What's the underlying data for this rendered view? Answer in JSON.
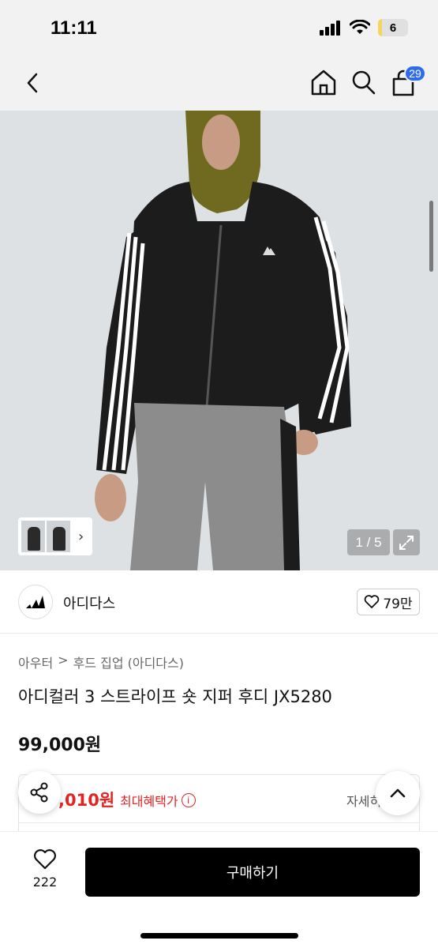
{
  "status_bar": {
    "time": "11:11",
    "battery_level": "6",
    "battery_fraction": 0.06
  },
  "nav": {
    "cart_count": "29"
  },
  "hero": {
    "counter": "1 / 5"
  },
  "brand": {
    "name": "아디다스",
    "likes": "79만"
  },
  "breadcrumb": {
    "first": "아우터",
    "separator": ">",
    "second": "후드 집업 (아디다스)"
  },
  "product": {
    "title": "아디컬러 3 스트라이프 숏 지퍼 후디 JX5280",
    "price": "99,000원"
  },
  "benefit": {
    "price_partial": ",010원",
    "label": "최대혜택가",
    "info": "i",
    "detail": "자세히"
  },
  "bottom": {
    "wish_count": "222",
    "buy_label": "구매하기"
  },
  "colors": {
    "accent_red": "#e52222",
    "badge_blue": "#2f6bf0",
    "buy_black": "#000000"
  }
}
